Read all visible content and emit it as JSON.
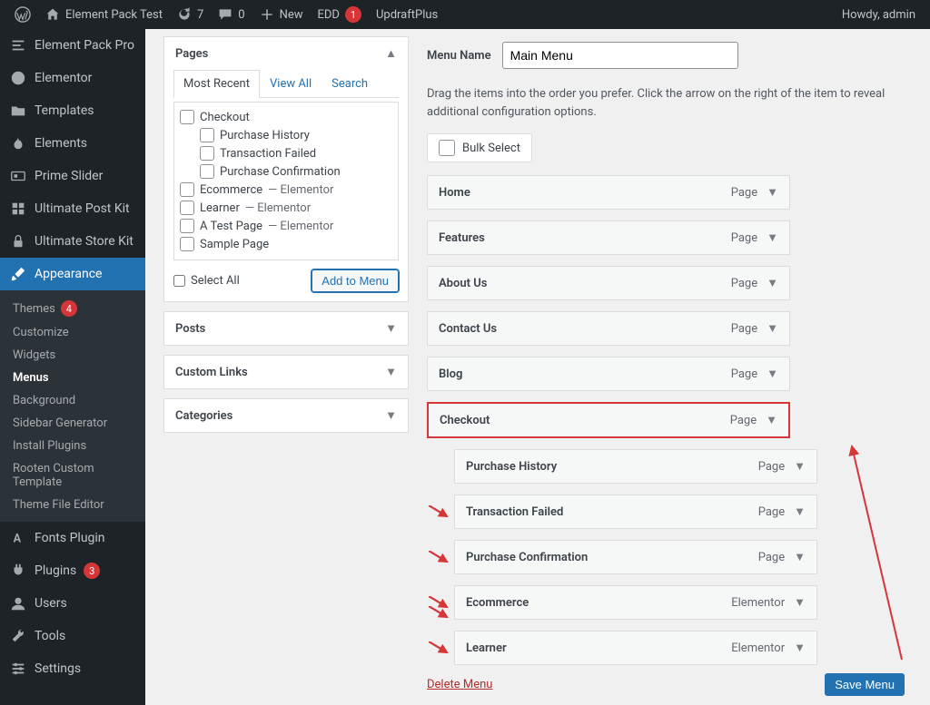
{
  "adminbar": {
    "site_title": "Element Pack Test",
    "refresh_count": "7",
    "comments_count": "0",
    "new_label": "New",
    "edd_label": "EDD",
    "edd_count": "1",
    "updraft_label": "UpdraftPlus",
    "howdy": "Howdy, admin"
  },
  "sidebar": {
    "ep_pro": "Element Pack Pro",
    "elementor": "Elementor",
    "templates": "Templates",
    "elements": "Elements",
    "prime_slider": "Prime Slider",
    "ultimate_post_kit": "Ultimate Post Kit",
    "ultimate_store_kit": "Ultimate Store Kit",
    "appearance": "Appearance",
    "fonts_plugin": "Fonts Plugin",
    "plugins": "Plugins",
    "plugins_count": "3",
    "users": "Users",
    "tools": "Tools",
    "settings": "Settings"
  },
  "appearance_sub": {
    "themes": "Themes",
    "themes_count": "4",
    "customize": "Customize",
    "widgets": "Widgets",
    "menus": "Menus",
    "background": "Background",
    "sidebar_generator": "Sidebar Generator",
    "install_plugins": "Install Plugins",
    "rooten": "Rooten Custom Template",
    "theme_file_editor": "Theme File Editor"
  },
  "metabox": {
    "pages_title": "Pages",
    "posts_title": "Posts",
    "custom_links_title": "Custom Links",
    "categories_title": "Categories",
    "tab_recent": "Most Recent",
    "tab_viewall": "View All",
    "tab_search": "Search",
    "select_all": "Select All",
    "add_to_menu": "Add to Menu",
    "pages": [
      {
        "label": "Checkout",
        "indent": false,
        "suffix": ""
      },
      {
        "label": "Purchase History",
        "indent": true,
        "suffix": ""
      },
      {
        "label": "Transaction Failed",
        "indent": true,
        "suffix": ""
      },
      {
        "label": "Purchase Confirmation",
        "indent": true,
        "suffix": ""
      },
      {
        "label": "Ecommerce",
        "indent": false,
        "suffix": "— Elementor"
      },
      {
        "label": "Learner",
        "indent": false,
        "suffix": "— Elementor"
      },
      {
        "label": "A Test Page",
        "indent": false,
        "suffix": "— Elementor"
      },
      {
        "label": "Sample Page",
        "indent": false,
        "suffix": ""
      }
    ]
  },
  "menu": {
    "name_label": "Menu Name",
    "name_value": "Main Menu",
    "instructions": "Drag the items into the order you prefer. Click the arrow on the right of the item to reveal additional configuration options.",
    "bulk_select": "Bulk Select",
    "delete_label": "Delete Menu",
    "save_label": "Save Menu",
    "items": [
      {
        "title": "Home",
        "type": "Page",
        "sub": false,
        "highlight": false
      },
      {
        "title": "Features",
        "type": "Page",
        "sub": false,
        "highlight": false
      },
      {
        "title": "About Us",
        "type": "Page",
        "sub": false,
        "highlight": false
      },
      {
        "title": "Contact Us",
        "type": "Page",
        "sub": false,
        "highlight": false
      },
      {
        "title": "Blog",
        "type": "Page",
        "sub": false,
        "highlight": false
      },
      {
        "title": "Checkout",
        "type": "Page",
        "sub": false,
        "highlight": true
      },
      {
        "title": "Purchase History",
        "type": "Page",
        "sub": true,
        "highlight": false
      },
      {
        "title": "Transaction Failed",
        "type": "Page",
        "sub": true,
        "highlight": false
      },
      {
        "title": "Purchase Confirmation",
        "type": "Page",
        "sub": true,
        "highlight": false
      },
      {
        "title": "Ecommerce",
        "type": "Elementor",
        "sub": true,
        "highlight": false
      },
      {
        "title": "Learner",
        "type": "Elementor",
        "sub": true,
        "highlight": false
      }
    ]
  }
}
